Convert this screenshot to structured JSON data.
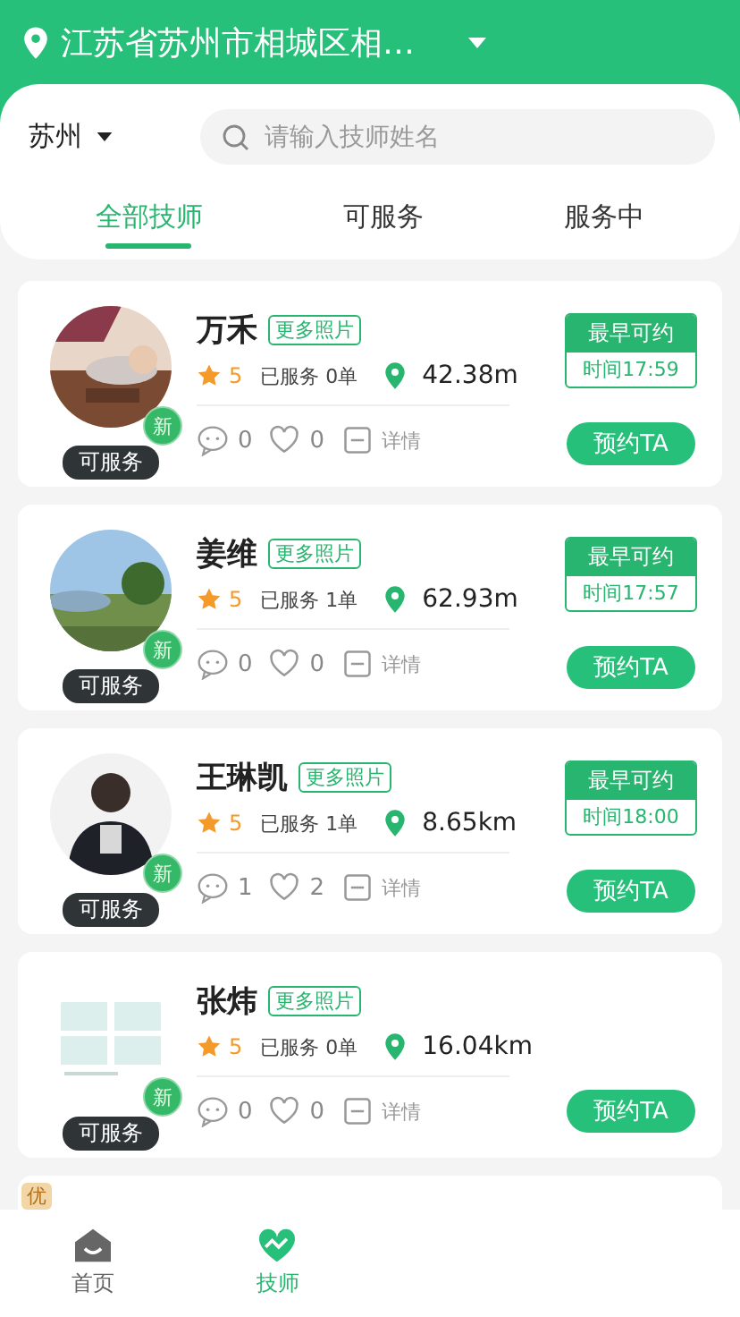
{
  "header": {
    "location": "江苏省苏州市相城区相…"
  },
  "city": "苏州",
  "search": {
    "placeholder": "请输入技师姓名"
  },
  "tabs": [
    {
      "label": "全部技师",
      "selected": true
    },
    {
      "label": "可服务",
      "selected": false
    },
    {
      "label": "服务中",
      "selected": false
    }
  ],
  "technicians": [
    {
      "name": "万禾",
      "photos_tag": "更多照片",
      "new_badge": "新",
      "status": "可服务",
      "rating": "5",
      "served": "已服务 0单",
      "distance": "42.38m",
      "comments": "0",
      "likes": "0",
      "details": "详情",
      "slot": {
        "title": "最早可约",
        "time": "时间17:59"
      },
      "button": "预约TA"
    },
    {
      "name": "姜维",
      "photos_tag": "更多照片",
      "new_badge": "新",
      "status": "可服务",
      "rating": "5",
      "served": "已服务 1单",
      "distance": "62.93m",
      "comments": "0",
      "likes": "0",
      "details": "详情",
      "slot": {
        "title": "最早可约",
        "time": "时间17:57"
      },
      "button": "预约TA"
    },
    {
      "name": "王琳凯",
      "photos_tag": "更多照片",
      "new_badge": "新",
      "status": "可服务",
      "rating": "5",
      "served": "已服务 1单",
      "distance": "8.65km",
      "comments": "1",
      "likes": "2",
      "details": "详情",
      "slot": {
        "title": "最早可约",
        "time": "时间18:00"
      },
      "button": "预约TA"
    },
    {
      "name": "张炜",
      "photos_tag": "更多照片",
      "new_badge": "新",
      "status": "可服务",
      "rating": "5",
      "served": "已服务 0单",
      "distance": "16.04km",
      "comments": "0",
      "likes": "0",
      "details": "详情",
      "button": "预约TA"
    }
  ],
  "partial_card": {
    "badge": "优"
  },
  "nav": [
    {
      "label": "首页",
      "selected": false,
      "kind": "home"
    },
    {
      "label": "技师",
      "selected": true,
      "kind": "heart"
    }
  ]
}
